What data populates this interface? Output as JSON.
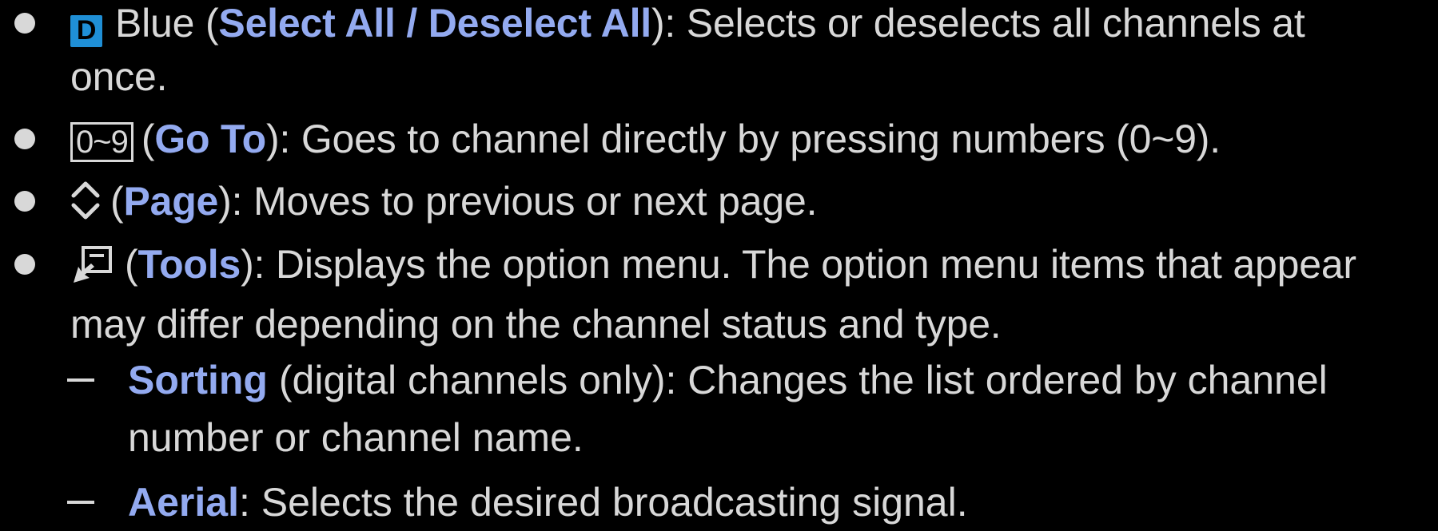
{
  "items": [
    {
      "icon": "blue-d-button-icon",
      "icon_label": "D",
      "pre": "Blue (",
      "keyword": "Select All / Deselect All",
      "post": "): Selects or deselects all channels at",
      "line2": "once."
    },
    {
      "icon": "number-keys-icon",
      "icon_label": "0~9",
      "pre": "(",
      "keyword": "Go To",
      "post": "): Goes to channel directly by pressing numbers (0~9)."
    },
    {
      "icon": "page-up-down-icon",
      "pre": "(",
      "keyword": "Page",
      "post": "): Moves to previous or next page."
    },
    {
      "icon": "tools-icon",
      "pre": "(",
      "keyword": "Tools",
      "post": "): Displays the option menu. The option menu items that appear",
      "line2": "may differ depending on the channel status and type."
    }
  ],
  "subitems": [
    {
      "keyword": "Sorting",
      "post": " (digital channels only): Changes the list ordered by channel",
      "line2": "number or channel name."
    },
    {
      "keyword": "Aerial",
      "post": ": Selects the desired broadcasting signal."
    }
  ],
  "colors": {
    "background": "#000000",
    "text": "#d8d8d8",
    "highlight": "#93aaf0",
    "blue_button": "#1f8fd6"
  }
}
